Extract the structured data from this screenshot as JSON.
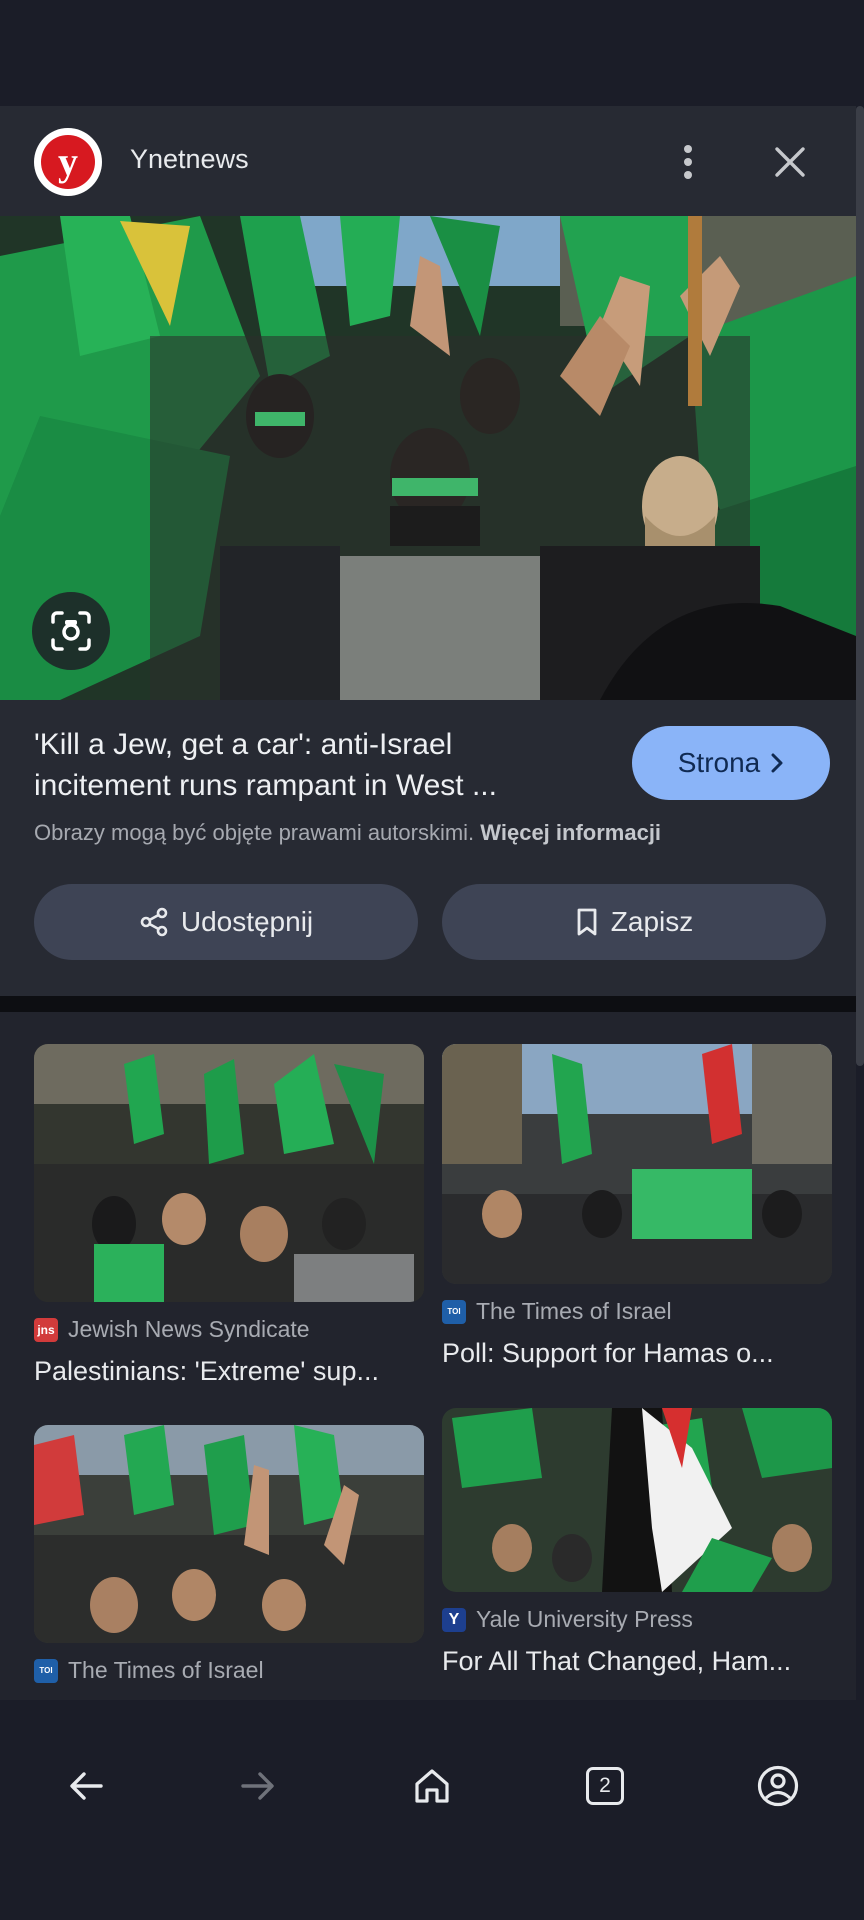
{
  "header": {
    "source_name": "Ynetnews",
    "logo_letter": "y",
    "brand_color": "#d71920"
  },
  "article": {
    "title_line1": "'Kill a Jew, get a car': anti-Israel",
    "title_line2": "incitement runs rampant in West ...",
    "visit_label": "Strona",
    "copyright_text": "Obrazy mogą być objęte prawami autorskimi.",
    "more_info_label": "Więcej informacji",
    "share_label": "Udostępnij",
    "save_label": "Zapisz"
  },
  "results": [
    {
      "source": "Jewish News Syndicate",
      "favicon_text": "jns",
      "favicon_color": "#d23b3b",
      "title": "Palestinians: 'Extreme' sup..."
    },
    {
      "source": "The Times of Israel",
      "favicon_text": "TOI",
      "favicon_color": "#1f5fa8",
      "title": "Poll: Support for Hamas o..."
    },
    {
      "source": "The Times of Israel",
      "favicon_text": "TOI",
      "favicon_color": "#1f5fa8",
      "title": ""
    },
    {
      "source": "Yale University Press",
      "favicon_text": "Y",
      "favicon_color": "#1d3f8f",
      "title": "For All That Changed, Ham..."
    }
  ],
  "bottom_nav": {
    "tab_count": "2"
  },
  "colors": {
    "accent": "#8ab4f8",
    "pill_bg": "#3e4455",
    "sheet_bg": "#272a33"
  }
}
